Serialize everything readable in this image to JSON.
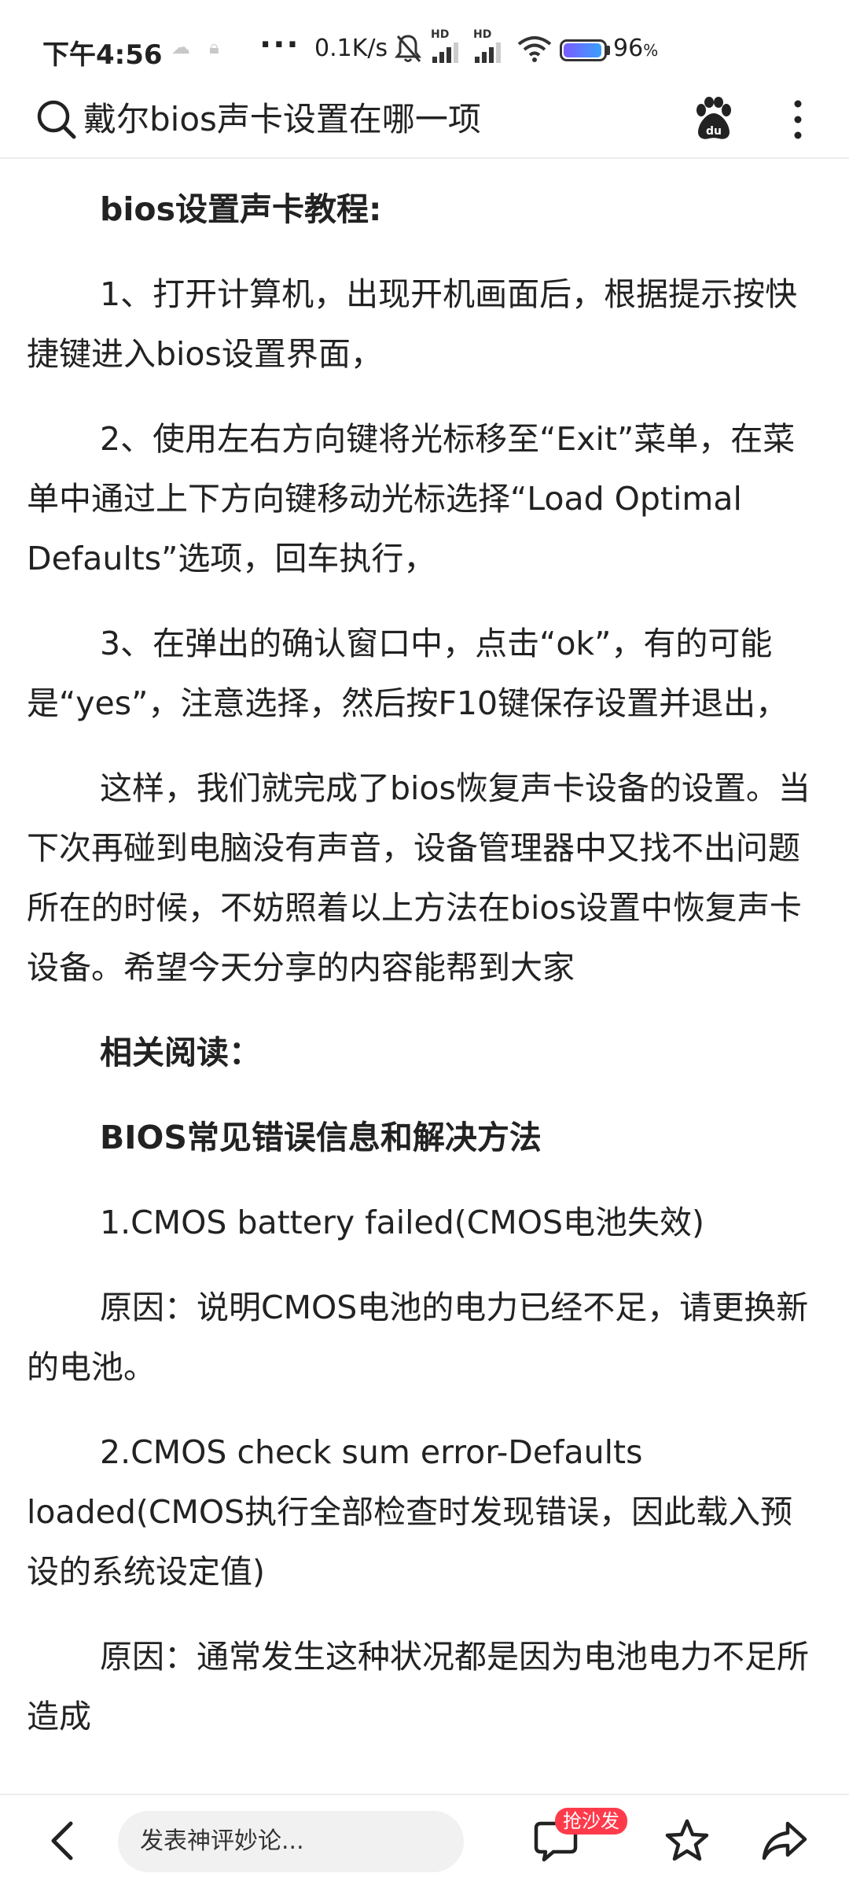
{
  "status_bar": {
    "time": "下午4:56",
    "dots": "···",
    "net_speed": "0.1K/s",
    "signal_1_label": "HD",
    "signal_2_label": "HD",
    "battery_percent": "96",
    "battery_unit": "%",
    "battery_level": 0.96,
    "icons": [
      "cloud-icon",
      "lock-icon",
      "mute-bell-icon",
      "signal-icon",
      "signal-icon",
      "wifi-icon",
      "battery-icon"
    ]
  },
  "search": {
    "query": "戴尔bios声卡设置在哪一项",
    "icons": [
      "search-icon",
      "baidu-paw-icon",
      "more-vertical-icon"
    ]
  },
  "article": {
    "paragraphs": [
      {
        "type": "heading",
        "text": "bios设置声卡教程:"
      },
      {
        "type": "text",
        "text": "1、打开计算机，出现开机画面后，根据提示按快捷键进入bios设置界面，"
      },
      {
        "type": "text",
        "text": "2、使用左右方向键将光标移至“Exit”菜单，在菜单中通过上下方向键移动光标选择“Load Optimal Defaults”选项，回车执行，"
      },
      {
        "type": "text",
        "text": "3、在弹出的确认窗口中，点击“ok”，有的可能是“yes”，注意选择，然后按F10键保存设置并退出，"
      },
      {
        "type": "text",
        "text": "这样，我们就完成了bios恢复声卡设备的设置。当下次再碰到电脑没有声音，设备管理器中又找不出问题所在的时候，不妨照着以上方法在bios设置中恢复声卡设备。希望今天分享的内容能帮到大家"
      },
      {
        "type": "heading",
        "text": "相关阅读："
      },
      {
        "type": "heading",
        "text": "BIOS常见错误信息和解决方法"
      },
      {
        "type": "text",
        "text": "1.CMOS battery failed(CMOS电池失效)"
      },
      {
        "type": "text",
        "text": "原因：说明CMOS电池的电力已经不足，请更换新的电池。"
      },
      {
        "type": "text",
        "text": "2.CMOS check sum error-Defaults loaded(CMOS执行全部检查时发现错误，因此载入预设的系统设定值)"
      },
      {
        "type": "text",
        "text": "原因：通常发生这种状况都是因为电池电力不足所造成"
      }
    ]
  },
  "bottom_bar": {
    "comment_placeholder": "发表神评妙论...",
    "sofa_badge": "抢沙发",
    "icons": [
      "back-icon",
      "comment-icon",
      "star-icon",
      "share-icon"
    ]
  },
  "colors": {
    "badge": "#ff3b4b",
    "text": "#222222",
    "input_bg": "#f1f1f1"
  }
}
